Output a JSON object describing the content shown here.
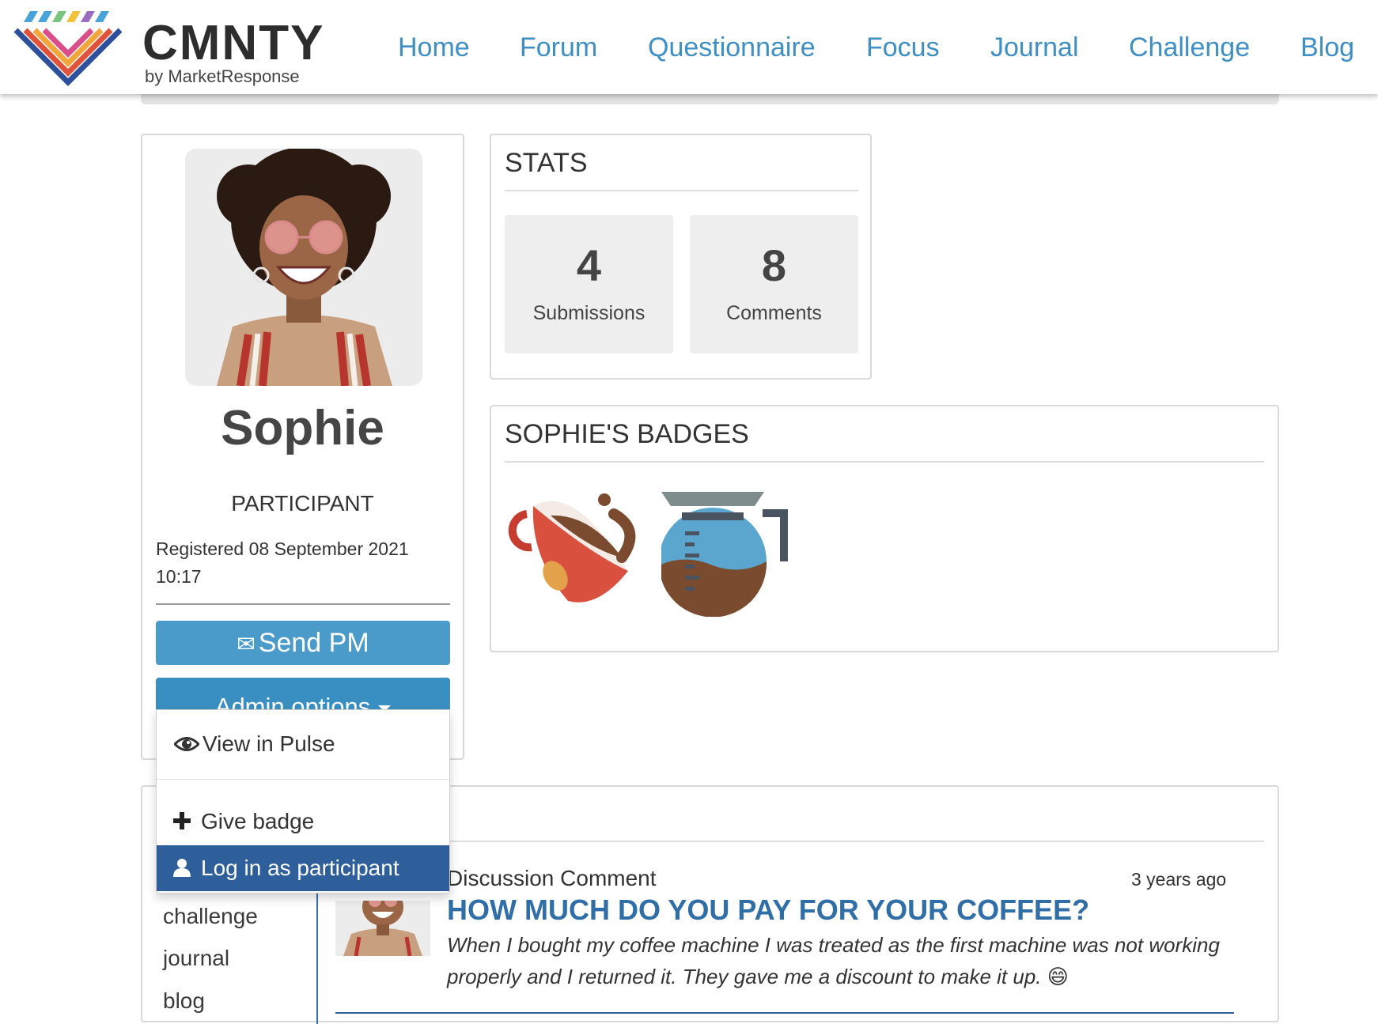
{
  "brand": {
    "name": "CMNTY",
    "tagline": "by MarketResponse",
    "colors": {
      "nav_link": "#3d8fc4",
      "primary_button": "#4a9aca",
      "active_item": "#2f5f9a",
      "title_link": "#2f6ea6"
    }
  },
  "nav": {
    "items": [
      {
        "label": "Home"
      },
      {
        "label": "Forum"
      },
      {
        "label": "Questionnaire"
      },
      {
        "label": "Focus"
      },
      {
        "label": "Journal"
      },
      {
        "label": "Challenge"
      },
      {
        "label": "Blog"
      }
    ]
  },
  "profile": {
    "name": "Sophie",
    "role": "PARTICIPANT",
    "registered": "Registered 08 September 2021 10:17",
    "send_pm_label": "Send PM",
    "send_pm_icon": "envelope-icon",
    "admin_options_label": "Admin options"
  },
  "admin_menu": {
    "items": [
      {
        "label": "View in Pulse",
        "icon": "eye-icon"
      },
      {
        "label": "Give badge",
        "icon": "plus-icon"
      },
      {
        "label": "Log in as participant",
        "icon": "user-icon",
        "active": true
      }
    ]
  },
  "stats": {
    "title": "STATS",
    "items": [
      {
        "value": "4",
        "label": "Submissions"
      },
      {
        "value": "8",
        "label": "Comments"
      }
    ]
  },
  "badges": {
    "title": "SOPHIE'S BADGES",
    "items": [
      {
        "icon": "coffee-cup-badge-icon"
      },
      {
        "icon": "coffee-pot-badge-icon"
      }
    ]
  },
  "activity": {
    "filters": [
      "challenge",
      "journal",
      "blog"
    ],
    "entries": [
      {
        "type": "Discussion Comment",
        "time": "3 years ago",
        "title": "HOW MUCH DO YOU PAY FOR YOUR COFFEE?",
        "text": "When I bought my coffee machine I was treated as the first machine was not working properly and I returned it. They gave me a discount to make it up. 😄"
      }
    ]
  }
}
